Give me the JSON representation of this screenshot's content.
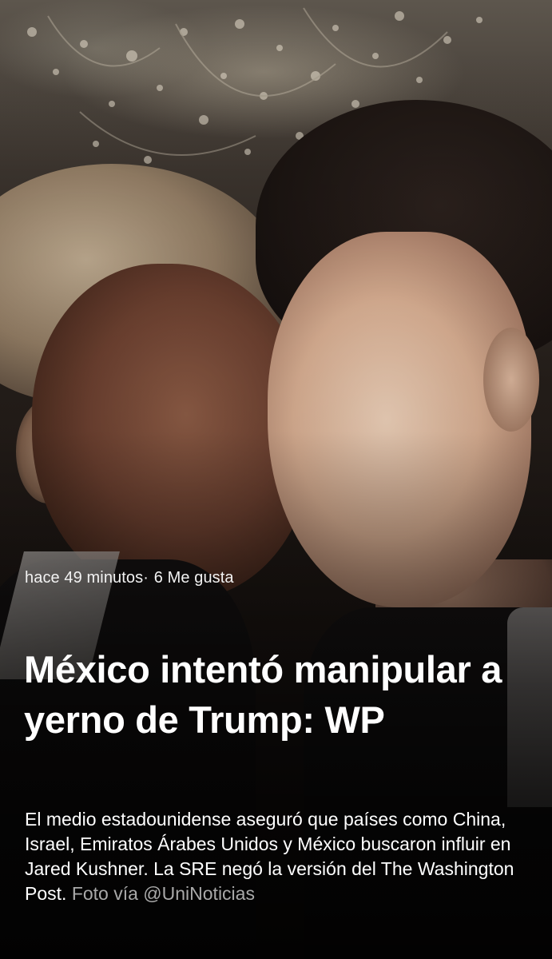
{
  "story": {
    "meta": {
      "time": "hace 49 minutos",
      "separator": "·",
      "likes": "6 Me gusta"
    },
    "headline": "México intentó manipular a yerno de Trump: WP",
    "summary": "El medio estadounidense aseguró que países como China, Israel, Emiratos Árabes Unidos y México buscaron influir en Jared Kushner. La SRE negó la versión del The Washington Post.",
    "credit": "Foto vía @UniNoticias"
  },
  "colors": {
    "text": "#ffffff",
    "credit": "#a9a9a9"
  }
}
